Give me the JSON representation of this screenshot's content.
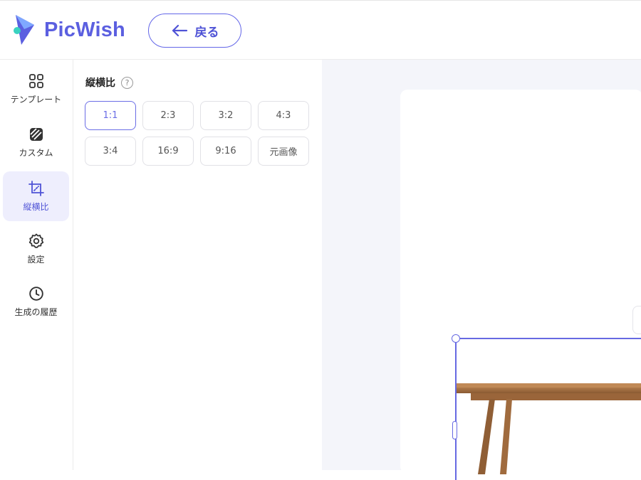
{
  "header": {
    "logo_text": "PicWish",
    "back_label": "戻る"
  },
  "sidebar": {
    "items": [
      {
        "label": "テンプレート",
        "icon": "template-grid-icon"
      },
      {
        "label": "カスタム",
        "icon": "custom-hatch-icon"
      },
      {
        "label": "縦横比",
        "icon": "crop-icon",
        "active": true
      },
      {
        "label": "設定",
        "icon": "gear-icon"
      },
      {
        "label": "生成の履歴",
        "icon": "clock-icon"
      }
    ]
  },
  "panel": {
    "title": "縦横比",
    "help_icon": "question-icon",
    "help_glyph": "?",
    "ratios": [
      "1:1",
      "2:3",
      "3:2",
      "4:3",
      "3:4",
      "16:9",
      "9:16",
      "元画像"
    ],
    "selected": "1:1"
  },
  "colors": {
    "accent": "#5b5fe0",
    "active_bg": "#eeeefd",
    "workspace_bg": "#f4f5fa"
  }
}
